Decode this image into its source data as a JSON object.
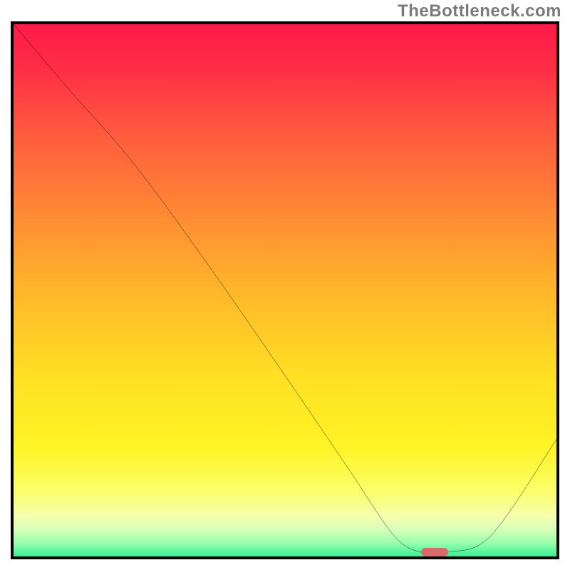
{
  "watermark": "TheBottleneck.com",
  "colors": {
    "frame": "#000000",
    "curve": "#000000",
    "marker": "#d96a6d",
    "gradient_stops": [
      {
        "offset": 0.0,
        "color": "#ff1a47"
      },
      {
        "offset": 0.08,
        "color": "#ff2d46"
      },
      {
        "offset": 0.2,
        "color": "#ff5a3e"
      },
      {
        "offset": 0.35,
        "color": "#ff8a34"
      },
      {
        "offset": 0.5,
        "color": "#ffb92a"
      },
      {
        "offset": 0.65,
        "color": "#ffe023"
      },
      {
        "offset": 0.78,
        "color": "#fff425"
      },
      {
        "offset": 0.86,
        "color": "#fbff6a"
      },
      {
        "offset": 0.905,
        "color": "#f6ffad"
      },
      {
        "offset": 0.93,
        "color": "#d9ffb9"
      },
      {
        "offset": 0.955,
        "color": "#9affae"
      },
      {
        "offset": 0.975,
        "color": "#4cf39a"
      },
      {
        "offset": 1.0,
        "color": "#14e77a"
      }
    ]
  },
  "chart_data": {
    "type": "line",
    "title": "",
    "xlabel": "",
    "ylabel": "",
    "xlim": [
      0,
      100
    ],
    "ylim": [
      0,
      100
    ],
    "grid": false,
    "legend": false,
    "note": "Values estimated from pixel positions; y measured from bottom (0) to top (100).",
    "series": [
      {
        "name": "bottleneck-curve",
        "x": [
          0,
          10,
          22,
          35,
          50,
          62,
          70,
          75,
          80,
          88,
          100
        ],
        "y": [
          100,
          88,
          74,
          56,
          34,
          16,
          4,
          0.8,
          0.8,
          4,
          22
        ]
      }
    ],
    "marker": {
      "name": "optimal-range",
      "x_start": 75,
      "x_end": 80,
      "y": 0.8
    }
  },
  "geometry": {
    "plot_inner_w": 762,
    "plot_inner_h": 747
  }
}
